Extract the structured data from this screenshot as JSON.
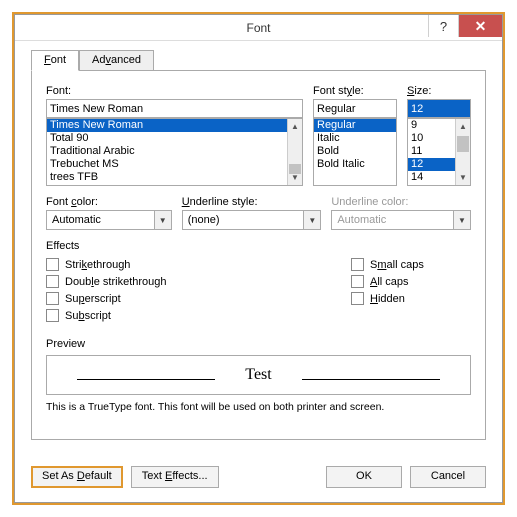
{
  "window": {
    "title": "Font"
  },
  "tabs": {
    "font": "Font",
    "advanced": "Advanced"
  },
  "font": {
    "label": "Font:",
    "value": "Times New Roman",
    "items": [
      "Times New Roman",
      "Total 90",
      "Traditional Arabic",
      "Trebuchet MS",
      "trees TFB"
    ],
    "selected": "Times New Roman"
  },
  "style": {
    "label": "Font style:",
    "value": "Regular",
    "items": [
      "Regular",
      "Italic",
      "Bold",
      "Bold Italic"
    ],
    "selected": "Regular"
  },
  "size": {
    "label": "Size:",
    "value": "12",
    "items": [
      "9",
      "10",
      "11",
      "12",
      "14"
    ],
    "selected": "12"
  },
  "color": {
    "label": "Font color:",
    "value": "Automatic"
  },
  "ulstyle": {
    "label": "Underline style:",
    "value": "(none)"
  },
  "ulcolor": {
    "label": "Underline color:",
    "value": "Automatic"
  },
  "effects": {
    "title": "Effects",
    "strike": "Strikethrough",
    "dstrike": "Double strikethrough",
    "sup": "Superscript",
    "sub": "Subscript",
    "smallcaps": "Small caps",
    "allcaps": "All caps",
    "hidden": "Hidden"
  },
  "preview": {
    "label": "Preview",
    "sample": "Test",
    "note": "This is a TrueType font. This font will be used on both printer and screen."
  },
  "buttons": {
    "default": "Set As Default",
    "effects": "Text Effects...",
    "ok": "OK",
    "cancel": "Cancel"
  }
}
